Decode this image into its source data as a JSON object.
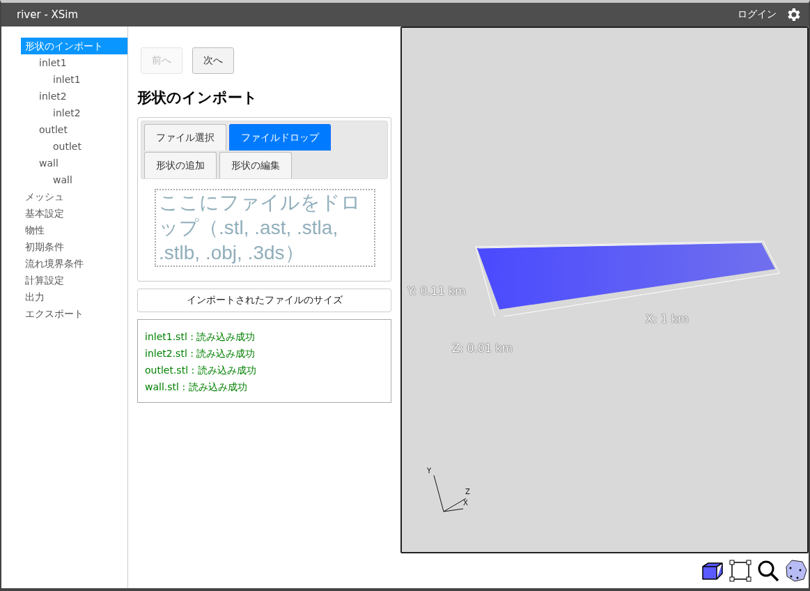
{
  "window": {
    "title": "river - XSim",
    "login": "ログイン"
  },
  "sidebar": {
    "items": [
      {
        "label": "形状のインポート",
        "selected": true,
        "children": [
          {
            "label": "inlet1",
            "selected": false,
            "children": [
              {
                "label": "inlet1",
                "selected": false
              }
            ]
          },
          {
            "label": "inlet2",
            "selected": false,
            "children": [
              {
                "label": "inlet2",
                "selected": false
              }
            ]
          },
          {
            "label": "outlet",
            "selected": false,
            "children": [
              {
                "label": "outlet",
                "selected": false
              }
            ]
          },
          {
            "label": "wall",
            "selected": false,
            "children": [
              {
                "label": "wall",
                "selected": false
              }
            ]
          }
        ]
      },
      {
        "label": "メッシュ",
        "selected": false
      },
      {
        "label": "基本設定",
        "selected": false
      },
      {
        "label": "物性",
        "selected": false
      },
      {
        "label": "初期条件",
        "selected": false
      },
      {
        "label": "流れ境界条件",
        "selected": false
      },
      {
        "label": "計算設定",
        "selected": false
      },
      {
        "label": "出力",
        "selected": false
      },
      {
        "label": "エクスポート",
        "selected": false
      }
    ]
  },
  "nav": [
    {
      "label": "前へ",
      "disabled": true
    },
    {
      "label": "次へ",
      "disabled": false
    }
  ],
  "heading": "形状のインポート",
  "tabs": [
    {
      "label": "ファイル選択",
      "selected": false
    },
    {
      "label": "ファイルドロップ",
      "selected": true
    },
    {
      "label": "形状の追加",
      "selected": false
    },
    {
      "label": "形状の編集",
      "selected": false
    }
  ],
  "drop_zone": {
    "text": "ここにファイルをドロップ（.stl, .ast, .stla, .stlb, .obj, .3ds）"
  },
  "size_button": "インポートされたファイルのサイズ",
  "log": [
    "inlet1.stl : 読み込み成功",
    "inlet2.stl : 読み込み成功",
    "outlet.stl : 読み込み成功",
    "wall.stl : 読み込み成功"
  ],
  "viewport": {
    "dimensions": {
      "y": "Y: 0.11 km",
      "x": "X: 1 km",
      "z": "Z: 0.01 km"
    },
    "axes": {
      "y": "Y",
      "z": "Z",
      "x": "X"
    }
  }
}
